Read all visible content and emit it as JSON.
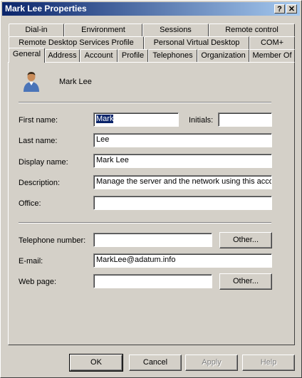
{
  "window": {
    "title": "Mark Lee Properties",
    "help_glyph": "?",
    "close_glyph": "✕"
  },
  "tabs": {
    "row1": [
      "Dial-in",
      "Environment",
      "Sessions",
      "Remote control"
    ],
    "row2": [
      "Remote Desktop Services Profile",
      "Personal Virtual Desktop",
      "COM+"
    ],
    "row3": [
      "General",
      "Address",
      "Account",
      "Profile",
      "Telephones",
      "Organization",
      "Member Of"
    ]
  },
  "header": {
    "user_name": "Mark Lee"
  },
  "form": {
    "first_name_label": "First name:",
    "first_name_value": "Mark",
    "initials_label": "Initials:",
    "initials_value": "",
    "last_name_label": "Last name:",
    "last_name_value": "Lee",
    "display_name_label": "Display name:",
    "display_name_value": "Mark Lee",
    "description_label": "Description:",
    "description_value": "Manage the server and the network using this accou",
    "office_label": "Office:",
    "office_value": "",
    "telephone_label": "Telephone number:",
    "telephone_value": "",
    "telephone_other": "Other...",
    "email_label": "E-mail:",
    "email_value": "MarkLee@adatum.info",
    "webpage_label": "Web page:",
    "webpage_value": "",
    "webpage_other": "Other..."
  },
  "buttons": {
    "ok": "OK",
    "cancel": "Cancel",
    "apply": "Apply",
    "help": "Help"
  },
  "colors": {
    "titlebar_start": "#0a246a",
    "titlebar_end": "#a6caf0",
    "face": "#d4d0c8"
  }
}
